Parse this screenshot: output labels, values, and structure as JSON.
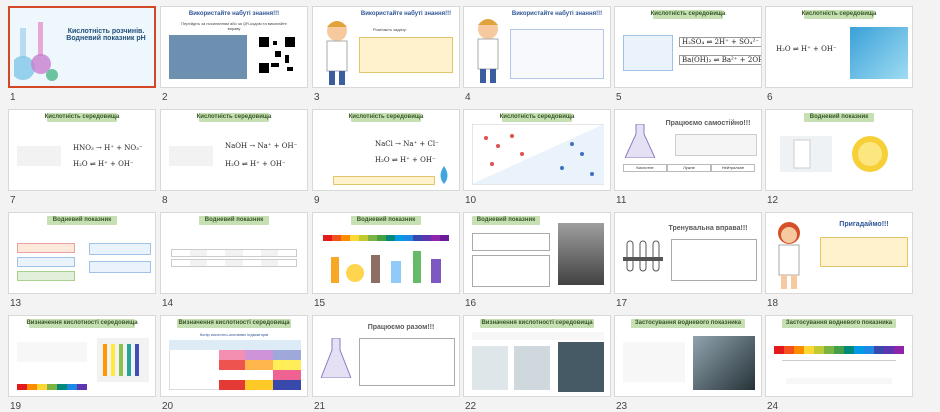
{
  "slides": [
    {
      "number": "1",
      "title": "Кислотність розчинів. Водневий показник pH"
    },
    {
      "number": "2",
      "title": "Використайте набуті знання!!!",
      "text": "Перейдіть за посиланням або за QR-кодом та виконайте вправу"
    },
    {
      "number": "3",
      "title": "Використайте набуті знання!!!",
      "text": "Розв'яжіть задачу:"
    },
    {
      "number": "4",
      "title": "Використайте набуті знання!!!"
    },
    {
      "number": "5",
      "title": "Кислотність середовища",
      "formulas": [
        "H₂SO₄ ⇌ 2H⁺ + SO₄²⁻",
        "Ba(OH)₂ ⇌ Ba²⁺ + 2OH⁻"
      ]
    },
    {
      "number": "6",
      "title": "Кислотність середовища",
      "formulas": [
        "H₂O ⇌ H⁺ + OH⁻"
      ]
    },
    {
      "number": "7",
      "title": "Кислотність середовища",
      "formulas": [
        "HNO₃ → H⁺ + NO₃⁻",
        "H₂O ⇌ H⁺ + OH⁻"
      ]
    },
    {
      "number": "8",
      "title": "Кислотність середовища",
      "formulas": [
        "NaOH → Na⁺ + OH⁻",
        "H₂O ⇌ H⁺ + OH⁻"
      ]
    },
    {
      "number": "9",
      "title": "Кислотність середовища",
      "formulas": [
        "NaCl → Na⁺ + Cl⁻",
        "H₂O ⇌ H⁺ + OH⁻"
      ]
    },
    {
      "number": "10",
      "title": "Кислотність середовища"
    },
    {
      "number": "11",
      "title": "Працюємо самостійно!!!",
      "columns": [
        "Кислотне",
        "Лужне",
        "Нейтральне"
      ]
    },
    {
      "number": "12",
      "title": "Водневий показник"
    },
    {
      "number": "13",
      "title": "Водневий показник"
    },
    {
      "number": "14",
      "title": "Водневий показник"
    },
    {
      "number": "15",
      "title": "Водневий показник"
    },
    {
      "number": "16",
      "title": "Водневий показник"
    },
    {
      "number": "17",
      "title": "Тренувальна вправа!!!"
    },
    {
      "number": "18",
      "title": "Пригадаймо!!!"
    },
    {
      "number": "19",
      "title": "Визначення кислотності середовища"
    },
    {
      "number": "20",
      "title": "Визначення кислотності середовища",
      "subtitle": "Колір кислотно-основних індикаторів"
    },
    {
      "number": "21",
      "title": "Працюємо разом!!!"
    },
    {
      "number": "22",
      "title": "Визначення кислотності середовища"
    },
    {
      "number": "23",
      "title": "Застосування водневого показника"
    },
    {
      "number": "24",
      "title": "Застосування водневого показника"
    }
  ],
  "colors": {
    "selected": "#d24726",
    "barGreen": "#c6e0b4",
    "titleBlue": "#2f5597"
  }
}
